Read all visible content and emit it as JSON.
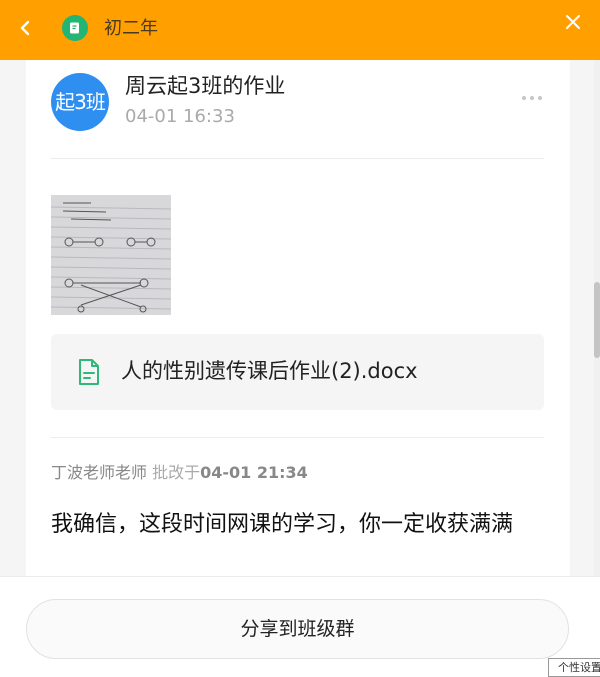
{
  "header": {
    "back_icon": "chevron-left-icon",
    "app_icon": "homework-app-icon",
    "title": "初二年",
    "close_icon": "close-icon",
    "background": "#ff9f00"
  },
  "post": {
    "avatar_text": "起3班",
    "avatar_color": "#2f8ff0",
    "title": "周云起3班的作业",
    "time": "04-01 16:33",
    "more_icon": "more-dots-icon",
    "image_alt": "作业照片",
    "attachment": {
      "icon": "document-icon",
      "name": "人的性别遗传课后作业(2).docx"
    }
  },
  "comment": {
    "teacher": "丁波老师老师",
    "action": " 批改于",
    "time": "04-01 21:34",
    "text": "我确信，这段时间网课的学习，你一定收获满满"
  },
  "footer": {
    "share_label": "分享到班级群"
  },
  "tooltip": {
    "text": "个性设置"
  }
}
